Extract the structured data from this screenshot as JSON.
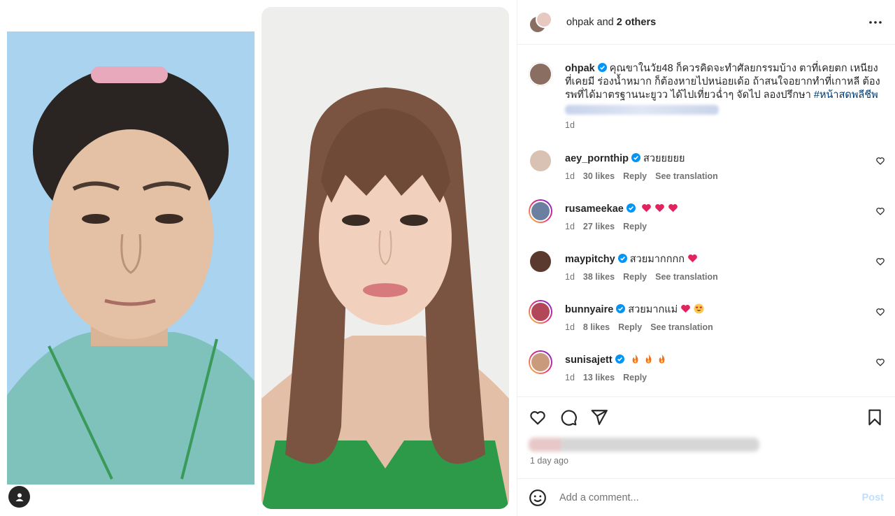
{
  "header": {
    "username": "ohpak",
    "and_text": " and ",
    "others_text": "2 others"
  },
  "caption": {
    "username": "ohpak",
    "text": "คุณขาในวัย48 ก็ควรคิดจะทำศัลยกรรมบ้าง ตาที่เคยตก เหนียงที่เคยมี ร่องน้ำหมาก ก็ต้องหายไปหน่อยเด้อ ถ้าสนใจอยากทำที่เกาหลี ต้องรพที่ได้มาตรฐานนะยูวว ได้ไปเที่ยวฉ่ำๆ จัดไป ลองปรึกษา ",
    "hashtag": "#หน้าสดพลีชีพ",
    "time": "1d"
  },
  "comments": [
    {
      "username": "aey_pornthip",
      "verified": true,
      "text": "สวยยยยย",
      "emojis": [],
      "time": "1d",
      "likes": "30 likes",
      "reply": "Reply",
      "translate": "See translation",
      "avatar_color": "#d9c2b4"
    },
    {
      "username": "rusameekae",
      "verified": true,
      "text": "",
      "emojis": [
        "heart",
        "heart",
        "heart"
      ],
      "time": "1d",
      "likes": "27 likes",
      "reply": "Reply",
      "translate": "",
      "avatar_color": "#6b7fa0"
    },
    {
      "username": "maypitchy",
      "verified": true,
      "text": "สวยมากกกก",
      "emojis": [
        "heart"
      ],
      "time": "1d",
      "likes": "38 likes",
      "reply": "Reply",
      "translate": "See translation",
      "avatar_color": "#5a3a2e"
    },
    {
      "username": "bunnyaire",
      "verified": true,
      "text": "สวยมากแม่",
      "emojis": [
        "heart",
        "heart-eyes"
      ],
      "time": "1d",
      "likes": "8 likes",
      "reply": "Reply",
      "translate": "See translation",
      "avatar_color": "#b2475a"
    },
    {
      "username": "sunisajett",
      "verified": true,
      "text": "",
      "emojis": [
        "fire",
        "fire",
        "fire"
      ],
      "time": "1d",
      "likes": "13 likes",
      "reply": "Reply",
      "translate": "",
      "avatar_color": "#c99a7b"
    }
  ],
  "footer": {
    "time": "1 day ago",
    "comment_placeholder": "Add a comment...",
    "post_label": "Post"
  },
  "icons": {
    "more": "more-options-icon",
    "like": "heart-icon",
    "comment": "comment-icon",
    "share": "send-icon",
    "save": "bookmark-icon",
    "emoji": "emoji-icon",
    "tagged": "tagged-user-icon"
  },
  "colors": {
    "verified": "#0095f6",
    "link": "#00376b",
    "secondary_text": "#737373",
    "post_disabled": "#c0dffd"
  }
}
